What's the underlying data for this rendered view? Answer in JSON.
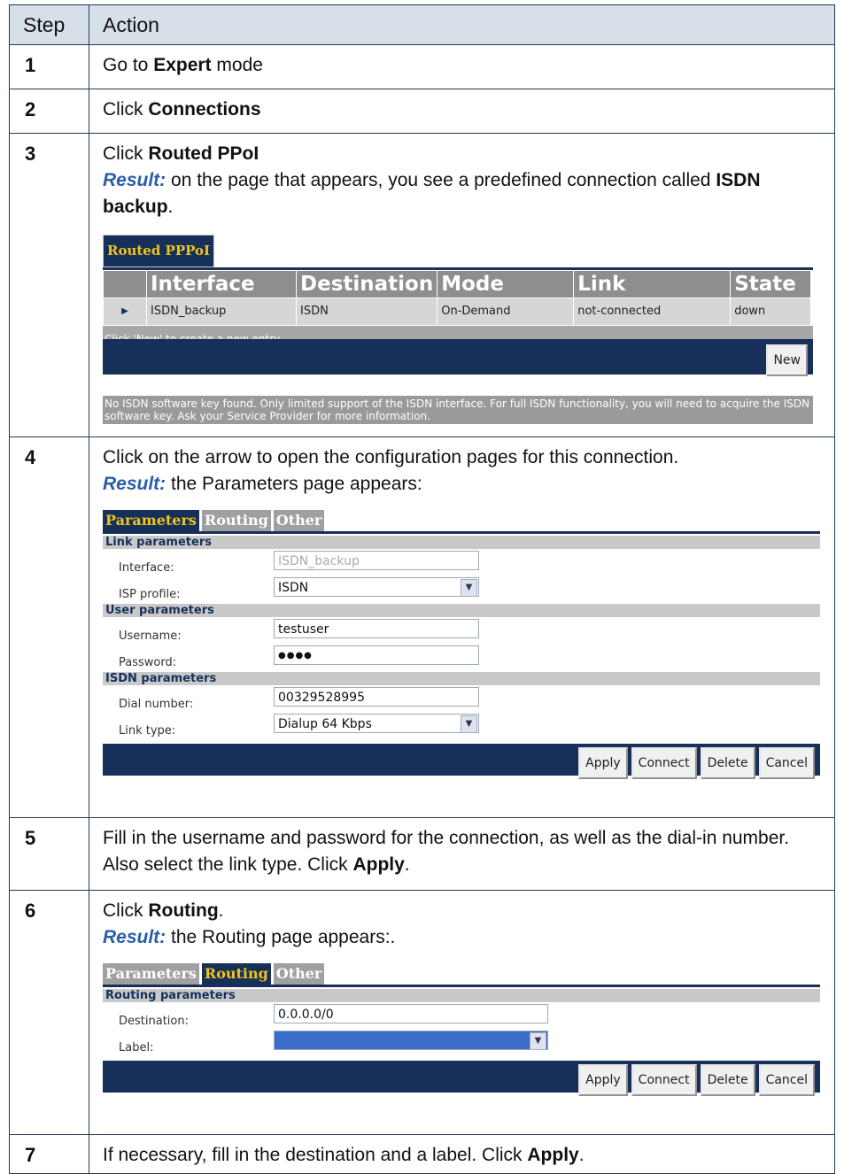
{
  "header": {
    "step": "Step",
    "action": "Action"
  },
  "steps": {
    "s1": {
      "num": "1",
      "pre": "Go to ",
      "bold": "Expert",
      "post": " mode"
    },
    "s2": {
      "num": "2",
      "pre": "Click ",
      "bold": "Connections"
    },
    "s3": {
      "num": "3",
      "pre": "Click ",
      "bold": "Routed PPoI",
      "result_label": "Result:",
      "result_text": " on the page that appears, you see a predefined connection called ",
      "result_bold": "ISDN backup",
      "result_end": "."
    },
    "s4": {
      "num": "4",
      "text": "Click on the arrow to open the configuration pages for this connection.",
      "result_label": "Result:",
      "result_text": " the Parameters page appears:"
    },
    "s5": {
      "num": "5",
      "text": "Fill in the username and password for the connection, as well as the dial-in number. Also select the link type. Click ",
      "bold": "Apply",
      "end": "."
    },
    "s6": {
      "num": "6",
      "pre": "Click ",
      "bold": "Routing",
      "end": ".",
      "result_label": "Result:",
      "result_text": " the Routing page appears:."
    },
    "s7": {
      "num": "7",
      "text": "If necessary, fill in the destination and a label. Click ",
      "bold": "Apply",
      "end": "."
    }
  },
  "pppoi_shot": {
    "title": "Routed PPPoI",
    "columns": [
      "",
      "Interface",
      "Destination",
      "Mode",
      "Link",
      "State"
    ],
    "row": {
      "arrow": "▶",
      "interface": "ISDN_backup",
      "destination": "ISDN",
      "mode": "On-Demand",
      "link": "not-connected",
      "state": "down"
    },
    "hint": "Click 'New' to create a new entry.",
    "new_button": "New",
    "notice": "No ISDN software key found. Only limited support of the ISDN interface. For full ISDN functionality, you will need to acquire the ISDN software key. Ask your Service Provider for more information."
  },
  "params_shot": {
    "tabs": [
      "Parameters",
      "Routing",
      "Other"
    ],
    "link_section": "Link parameters",
    "interface_label": "Interface:",
    "interface_value": "ISDN_backup",
    "isp_label": "ISP profile:",
    "isp_value": "ISDN",
    "user_section": "User parameters",
    "username_label": "Username:",
    "username_value": "testuser",
    "password_label": "Password:",
    "password_value": "●●●●",
    "isdn_section": "ISDN parameters",
    "dial_label": "Dial number:",
    "dial_value": "00329528995",
    "linktype_label": "Link type:",
    "linktype_value": "Dialup 64 Kbps",
    "buttons": {
      "apply": "Apply",
      "connect": "Connect",
      "delete": "Delete",
      "cancel": "Cancel"
    }
  },
  "routing_shot": {
    "tabs": [
      "Parameters",
      "Routing",
      "Other"
    ],
    "section": "Routing parameters",
    "destination_label": "Destination:",
    "destination_value": "0.0.0.0/0",
    "label_label": "Label:",
    "label_value": "",
    "buttons": {
      "apply": "Apply",
      "connect": "Connect",
      "delete": "Delete",
      "cancel": "Cancel"
    }
  },
  "colors": {
    "dark_navy": "#16305a",
    "gold": "#f0c419",
    "header_bg": "#d7dfe9",
    "result_blue": "#2a5ea8"
  },
  "icons": {
    "dropdown": "chevron-down-icon",
    "row_arrow": "play-arrow-icon"
  }
}
